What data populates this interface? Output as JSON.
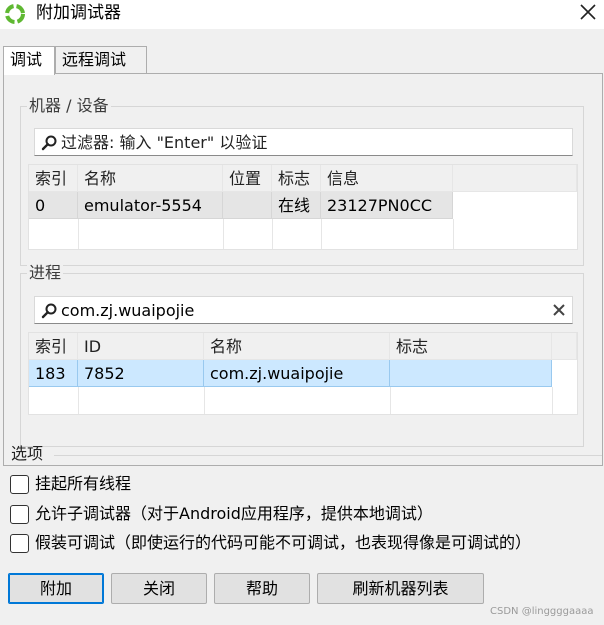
{
  "window": {
    "title": "附加调试器",
    "close_icon": "close-icon",
    "app_icon": "green-swirl-icon"
  },
  "tabs": [
    {
      "label": "调试",
      "active": true
    },
    {
      "label": "远程调试",
      "active": false
    }
  ],
  "machines": {
    "group_title": "机器 / 设备",
    "filter_placeholder": "过滤器: 输入 \"Enter\" 以验证",
    "columns": [
      "索引",
      "名称",
      "位置",
      "标志",
      "信息"
    ],
    "rows": [
      {
        "index": "0",
        "name": "emulator-5554",
        "location": "",
        "flag": "在线",
        "info": "23127PN0CC",
        "selected": true
      }
    ]
  },
  "processes": {
    "group_title": "进程",
    "filter_value": "com.zj.wuaipojie",
    "columns": [
      "索引",
      "ID",
      "名称",
      "标志"
    ],
    "rows": [
      {
        "index": "183",
        "id": "7852",
        "name": "com.zj.wuaipojie",
        "flag": "",
        "selected": true
      }
    ]
  },
  "options": {
    "title": "选项",
    "items": [
      {
        "label": "挂起所有线程",
        "checked": false
      },
      {
        "label": "允许子调试器（对于Android应用程序，提供本地调试）",
        "checked": false
      },
      {
        "label": "假装可调试（即使运行的代码可能不可调试，也表现得像是可调试的）",
        "checked": false
      }
    ]
  },
  "buttons": {
    "attach": "附加",
    "close": "关闭",
    "help": "帮助",
    "refresh": "刷新机器列表"
  },
  "watermark": "CSDN @linggggaaaa",
  "colors": {
    "selection_blue": "#cce8ff",
    "selection_gray": "#e5e5e5",
    "app_icon_green": "#5fb832",
    "default_button_border": "#0078d7"
  }
}
